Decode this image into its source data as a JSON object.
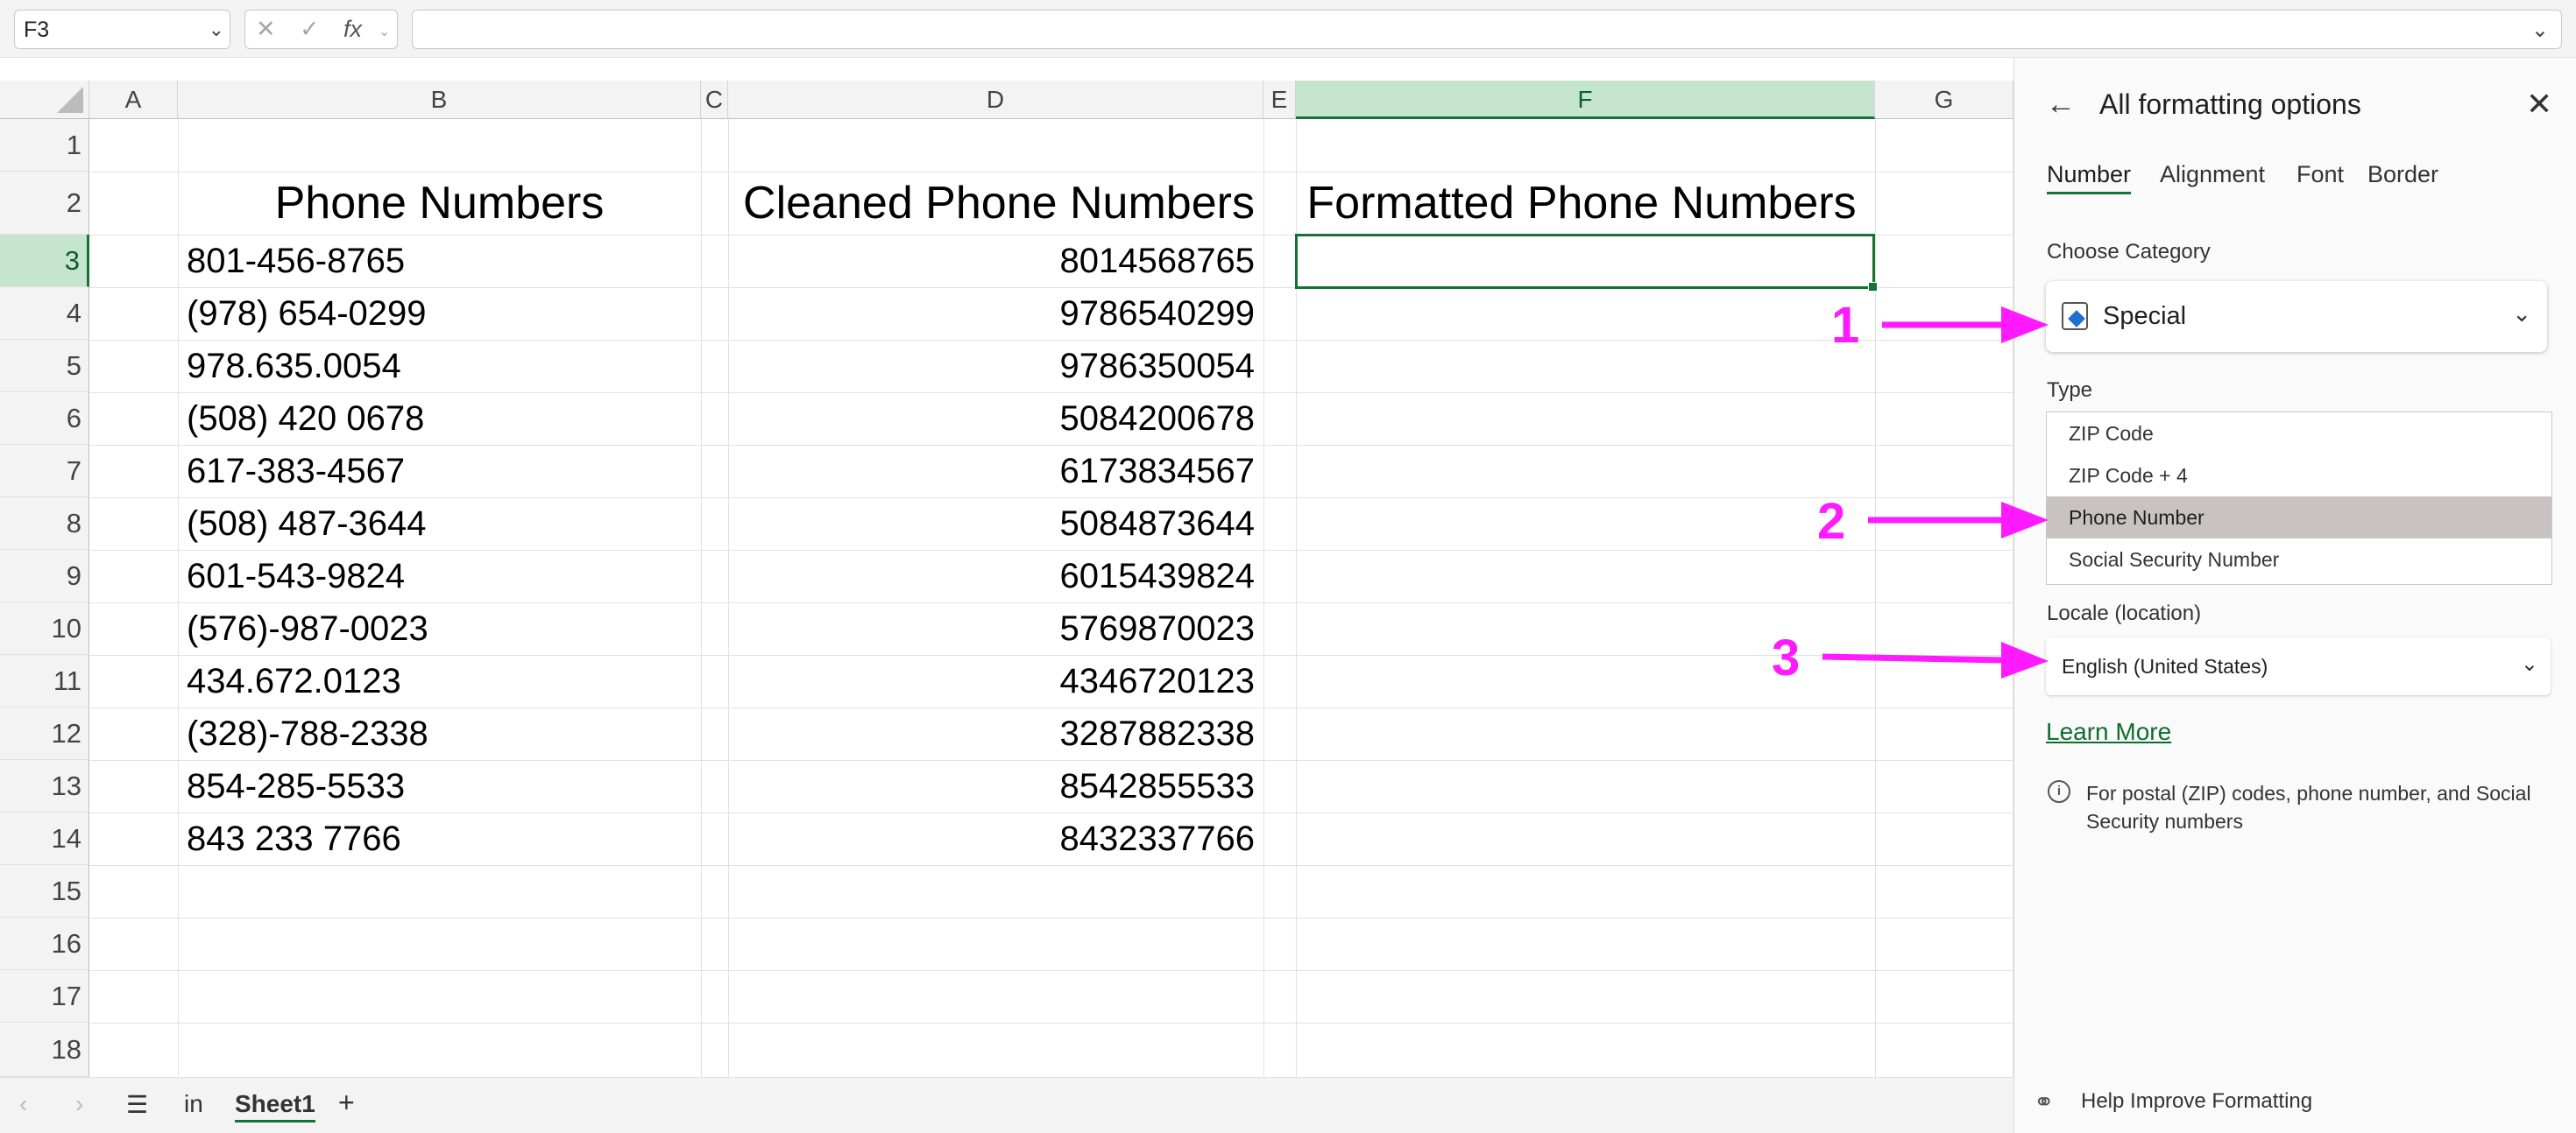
{
  "formula_bar": {
    "name_box": "F3",
    "fx_label": "fx",
    "formula_value": ""
  },
  "columns": [
    "A",
    "B",
    "C",
    "D",
    "E",
    "F",
    "G"
  ],
  "rows": [
    "1",
    "2",
    "3",
    "4",
    "5",
    "6",
    "7",
    "8",
    "9",
    "10",
    "11",
    "12",
    "13",
    "14",
    "15",
    "16",
    "17",
    "18"
  ],
  "headers": {
    "b": "Phone Numbers",
    "d": "Cleaned Phone Numbers",
    "f": "Formatted Phone Numbers"
  },
  "phone_numbers": [
    "801-456-8765",
    "(978) 654-0299",
    "978.635.0054",
    "(508) 420 0678",
    "617-383-4567",
    "(508) 487-3644",
    "601-543-9824",
    "(576)-987-0023",
    "434.672.0123",
    "(328)-788-2338",
    "854-285-5533",
    "843 233 7766"
  ],
  "cleaned_numbers": [
    "8014568765",
    "9786540299",
    "9786350054",
    "5084200678",
    "6173834567",
    "5084873644",
    "6015439824",
    "5769870023",
    "4346720123",
    "3287882338",
    "8542855533",
    "8432337766"
  ],
  "sheet_bar": {
    "tab_in": "in",
    "sheet_name": "Sheet1",
    "add": "+"
  },
  "pane": {
    "title": "All formatting options",
    "tabs": [
      "Number",
      "Alignment",
      "Font",
      "Border"
    ],
    "choose_category_label": "Choose Category",
    "category_value": "Special",
    "type_label": "Type",
    "types": [
      "ZIP Code",
      "ZIP Code + 4",
      "Phone Number",
      "Social Security Number"
    ],
    "selected_type": "Phone Number",
    "locale_label": "Locale (location)",
    "locale_value": "English (United States)",
    "learn_more": "Learn More",
    "info_text": "For postal (ZIP) codes, phone number, and Social Security numbers",
    "help_text": "Help Improve Formatting"
  },
  "annotations": [
    "1",
    "2",
    "3"
  ],
  "colors": {
    "accent_green": "#137333",
    "annotation_magenta": "#ff1aff",
    "selected_type_bg": "#c8c3c0"
  }
}
